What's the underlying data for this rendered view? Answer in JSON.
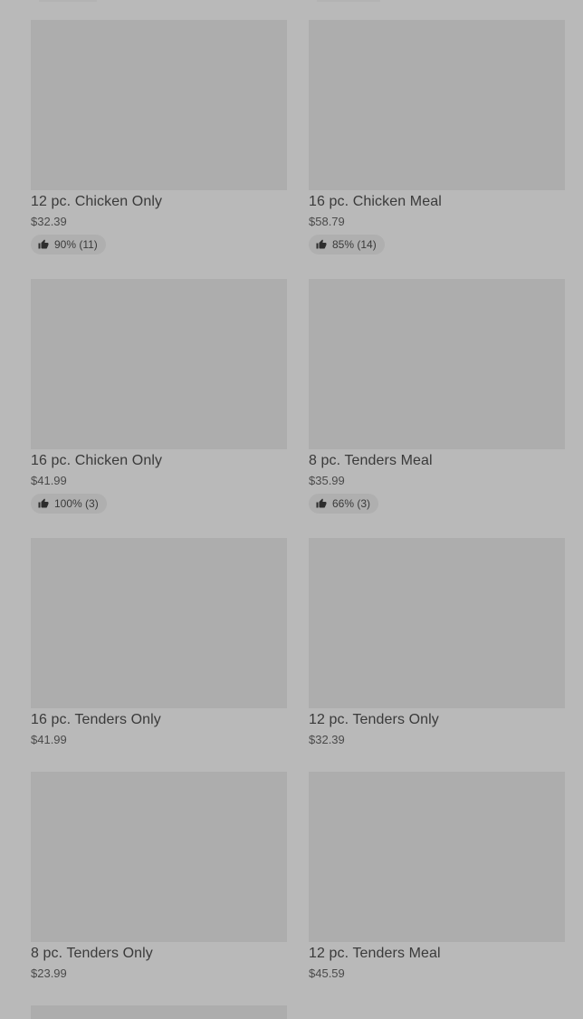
{
  "products": [
    {
      "name": "12 pc. Chicken Only",
      "price": "$32.39",
      "rating": "90% (11)"
    },
    {
      "name": "16 pc. Chicken Meal",
      "price": "$58.79",
      "rating": "85% (14)"
    },
    {
      "name": "16 pc. Chicken Only",
      "price": "$41.99",
      "rating": "100% (3)"
    },
    {
      "name": "8 pc. Tenders Meal",
      "price": "$35.99",
      "rating": "66% (3)"
    },
    {
      "name": "16 pc. Tenders Only",
      "price": "$41.99"
    },
    {
      "name": "12 pc. Tenders Only",
      "price": "$32.39"
    },
    {
      "name": "8 pc. Tenders Only",
      "price": "$23.99"
    },
    {
      "name": "12 pc. Tenders Meal",
      "price": "$45.59"
    }
  ],
  "icons": {
    "rating": "thumbs-up-icon"
  }
}
